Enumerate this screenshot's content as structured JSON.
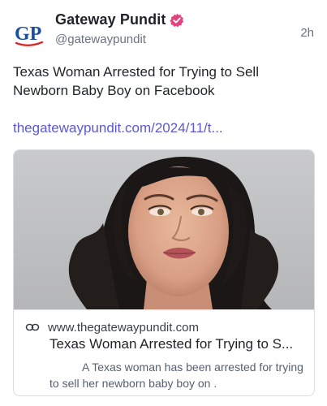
{
  "post": {
    "author_name": "Gateway Pundit",
    "handle": "@gatewaypundit",
    "timestamp": "2h",
    "avatar_text": "GP",
    "verified_icon": "verified-badge-icon",
    "text": "Texas Woman Arrested for Trying to Sell Newborn Baby Boy on Facebook",
    "link_text": "thegatewaypundit.com/2024/11/t..."
  },
  "card": {
    "image_icon": "mugshot-photo",
    "link_icon": "link-icon",
    "domain": "www.thegatewaypundit.com",
    "title": "Texas Woman Arrested for Trying to S...",
    "description": "A Texas woman has been arrested for trying to sell her newborn baby boy on ."
  },
  "colors": {
    "brand_blue": "#1a4fa0",
    "verified_pink": "#e4427e",
    "link_purple": "#5b58d6"
  }
}
